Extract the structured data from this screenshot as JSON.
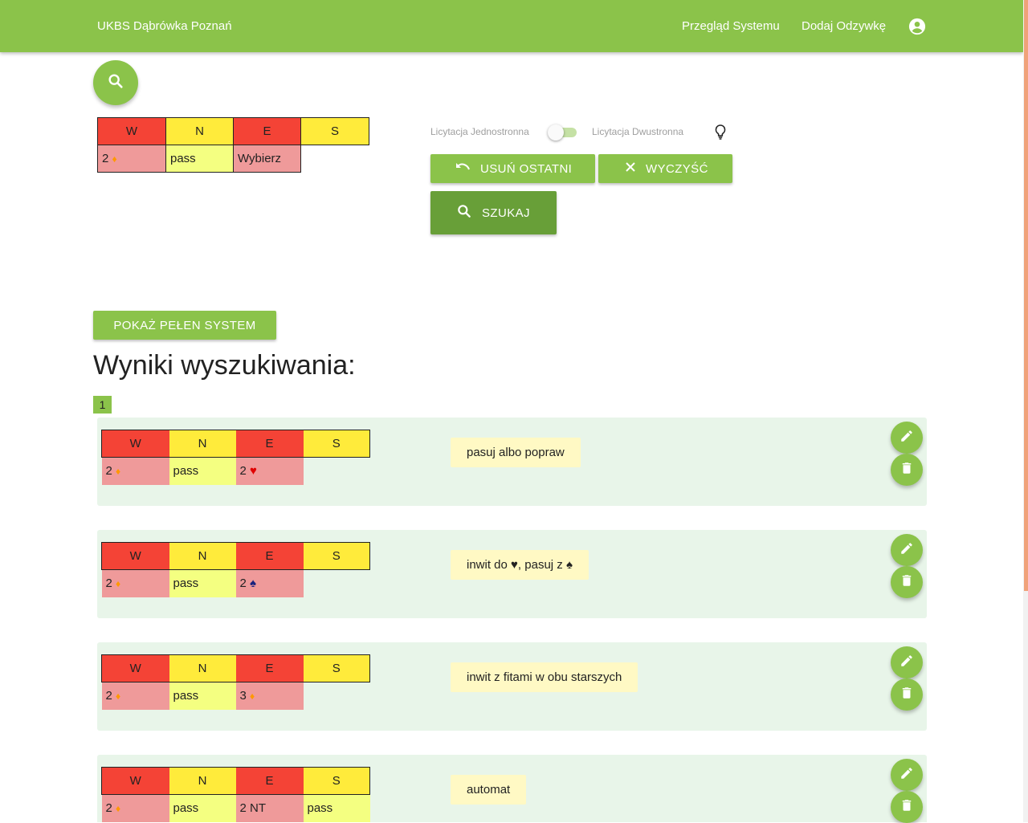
{
  "header": {
    "title": "UKBS Dąbrówka Poznań",
    "nav": [
      "Przegląd Systemu",
      "Dodaj Odzywkę"
    ]
  },
  "bidding": {
    "headers": [
      "W",
      "N",
      "E",
      "S"
    ],
    "row": [
      {
        "text": "2",
        "suit": "♦"
      },
      {
        "text": "pass",
        "suit": ""
      },
      {
        "text": "Wybierz",
        "suit": ""
      }
    ]
  },
  "toggle": {
    "left_label": "Licytacja Jednostronna",
    "right_label": "Licytacja Dwustronna"
  },
  "buttons": {
    "undo": "Usuń ostatni",
    "clear": "Wyczyść",
    "search": "Szukaj",
    "show_full": "Pokaż pełen system"
  },
  "results": {
    "heading": "Wyniki wyszukiwania:",
    "page": "1",
    "items": [
      {
        "bids": [
          {
            "text": "2",
            "suit": "♦"
          },
          {
            "text": "pass",
            "suit": ""
          },
          {
            "text": "2",
            "suit": "♥"
          },
          {
            "text": "",
            "suit": ""
          }
        ],
        "note": "pasuj albo popraw"
      },
      {
        "bids": [
          {
            "text": "2",
            "suit": "♦"
          },
          {
            "text": "pass",
            "suit": ""
          },
          {
            "text": "2",
            "suit": "♠"
          },
          {
            "text": "",
            "suit": ""
          }
        ],
        "note": "inwit do ♥, pasuj z ♠"
      },
      {
        "bids": [
          {
            "text": "2",
            "suit": "♦"
          },
          {
            "text": "pass",
            "suit": ""
          },
          {
            "text": "3",
            "suit": "♦"
          },
          {
            "text": "",
            "suit": ""
          }
        ],
        "note": "inwit z fitami w obu starszych"
      },
      {
        "bids": [
          {
            "text": "2",
            "suit": "♦"
          },
          {
            "text": "pass",
            "suit": ""
          },
          {
            "text": "2 NT",
            "suit": ""
          },
          {
            "text": "pass",
            "suit": ""
          }
        ],
        "note": "automat"
      }
    ]
  },
  "colors": {
    "primary": "#8bc34a",
    "primary_dark": "#689f38",
    "west_east_header": "#f44336",
    "north_south_header": "#ffeb3b",
    "west_east_cell": "#ef9a9a",
    "north_south_cell": "#f4ff81",
    "card_bg": "#e8f5e9",
    "note_bg": "#fff9c4"
  }
}
